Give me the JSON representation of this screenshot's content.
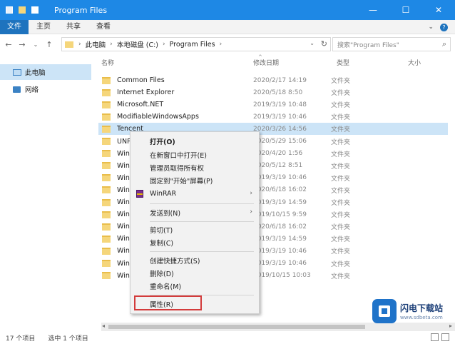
{
  "window": {
    "title": "Program Files",
    "buttons": [
      "—",
      "☐",
      "✕"
    ]
  },
  "ribbon": {
    "tabs": [
      "文件",
      "主页",
      "共享",
      "查看"
    ],
    "right_glyphs": [
      "⌄",
      "?"
    ]
  },
  "nav_buttons": [
    "←",
    "→",
    "⌄",
    "↑"
  ],
  "address": {
    "crumbs": [
      "此电脑",
      "本地磁盘 (C:)",
      "Program Files"
    ],
    "separator": "›",
    "dropdown": "⌄",
    "refresh": "↻"
  },
  "search": {
    "placeholder": "搜索\"Program Files\"",
    "icon": "⌕"
  },
  "sidebar": {
    "items": [
      {
        "label": "此电脑",
        "icon": "computer-icon"
      },
      {
        "label": "网络",
        "icon": "network-icon"
      }
    ]
  },
  "columns": {
    "name": "名称",
    "date": "修改日期",
    "type": "类型",
    "size": "大小",
    "sort_indicator": "^"
  },
  "files": [
    {
      "name": "Common Files",
      "date": "2020/2/17 14:19",
      "type": "文件夹"
    },
    {
      "name": "Internet Explorer",
      "date": "2020/5/18 8:50",
      "type": "文件夹"
    },
    {
      "name": "Microsoft.NET",
      "date": "2019/3/19 10:48",
      "type": "文件夹"
    },
    {
      "name": "ModifiableWindowsApps",
      "date": "2019/3/19 10:46",
      "type": "文件夹"
    },
    {
      "name": "Tencent",
      "date": "2020/3/26 14:56",
      "type": "文件夹"
    },
    {
      "name": "UNP",
      "date": "2020/5/29 15:06",
      "type": "文件夹"
    },
    {
      "name": "Wind",
      "date": "2020/4/20 1:56",
      "type": "文件夹"
    },
    {
      "name": "Wind",
      "date": "2020/5/12 8:51",
      "type": "文件夹"
    },
    {
      "name": "Wind",
      "date": "2019/3/19 10:46",
      "type": "文件夹"
    },
    {
      "name": "Wind",
      "date": "2020/6/18 16:02",
      "type": "文件夹"
    },
    {
      "name": "Wind",
      "date": "2019/3/19 14:59",
      "type": "文件夹"
    },
    {
      "name": "Wind",
      "date": "2019/10/15 9:59",
      "type": "文件夹"
    },
    {
      "name": "Wind",
      "date": "2020/6/18 16:02",
      "type": "文件夹"
    },
    {
      "name": "Wind",
      "date": "2019/3/19 14:59",
      "type": "文件夹"
    },
    {
      "name": "Wind",
      "date": "2019/3/19 10:46",
      "type": "文件夹"
    },
    {
      "name": "Wind",
      "date": "2019/3/19 10:46",
      "type": "文件夹"
    },
    {
      "name": "WinR",
      "date": "2019/10/15 10:03",
      "type": "文件夹"
    }
  ],
  "context_menu": {
    "open": "打开(O)",
    "open_new_window": "在新窗口中打开(E)",
    "take_ownership": "管理员取得所有权",
    "pin_start": "固定到\"开始\"屏幕(P)",
    "winrar": "WinRAR",
    "send_to": "发送到(N)",
    "cut": "剪切(T)",
    "copy": "复制(C)",
    "create_shortcut": "创建快捷方式(S)",
    "delete": "删除(D)",
    "rename": "重命名(M)",
    "properties": "属性(R)",
    "submenu_arrow": "›"
  },
  "status": {
    "count": "17 个项目",
    "selected": "选中 1 个项目"
  },
  "watermark": {
    "title": "闪电下载站",
    "url": "www.sdbeta.com"
  },
  "colors": {
    "titlebar": "#1e88e5",
    "selection": "#cce4f7",
    "highlight_border": "#d33b3b",
    "folder": "#f5d67b"
  }
}
